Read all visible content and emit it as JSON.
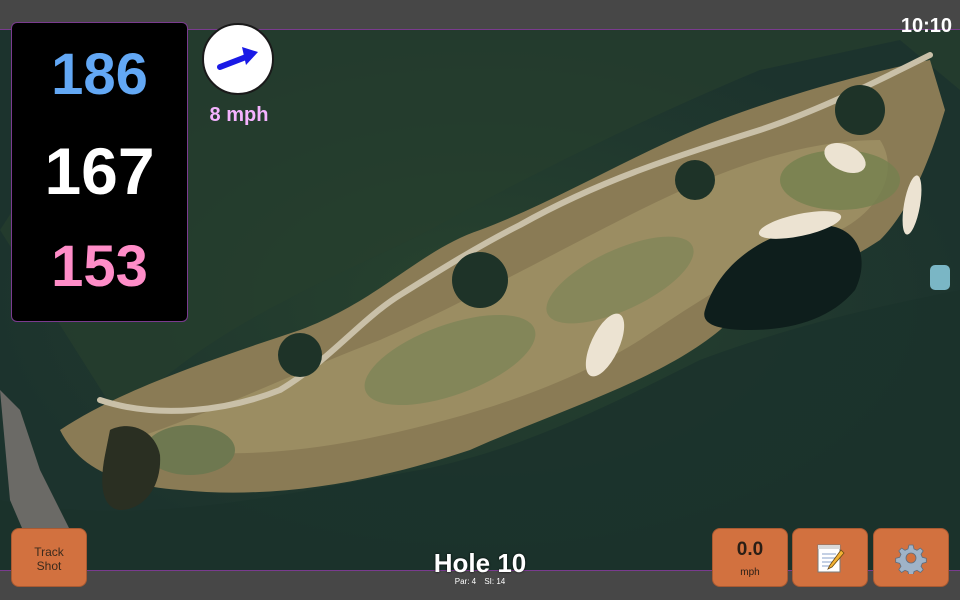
{
  "status": {
    "clock": "10:10"
  },
  "yardage": {
    "back": "186",
    "middle": "167",
    "front": "153"
  },
  "wind": {
    "speed_label": "8 mph",
    "arrow_icon": "wind-direction-arrow-icon",
    "arrow_color": "#1a1ae6"
  },
  "buttons": {
    "track_shot_line1": "Track",
    "track_shot_line2": "Shot",
    "speed_value": "0.0",
    "speed_unit": "mph",
    "notes_icon": "notepad-icon",
    "settings_icon": "gear-icon"
  },
  "hole": {
    "title": "Hole 10",
    "par": "Par: 4",
    "si": "SI: 14"
  },
  "colors": {
    "accent_border": "#7a3b8f",
    "button_bg": "#d2713f",
    "back_yardage": "#63a8f5",
    "middle_yardage": "#ffffff",
    "front_yardage": "#ff8dc8",
    "wind_text": "#f5b3ff"
  }
}
